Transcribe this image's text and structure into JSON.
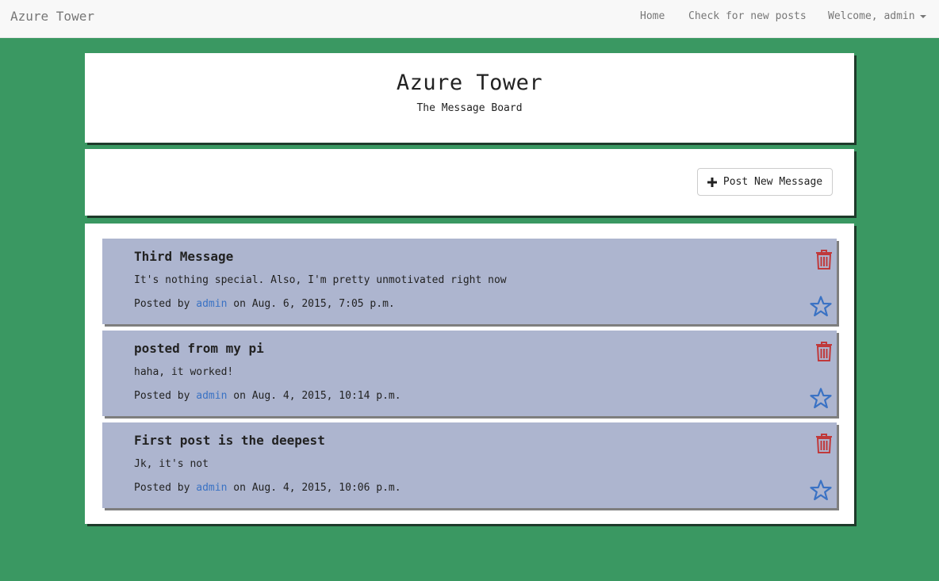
{
  "navbar": {
    "brand": "Azure Tower",
    "links": {
      "home": "Home",
      "check_posts": "Check for new posts",
      "user_menu": "Welcome, admin"
    }
  },
  "header": {
    "title": "Azure Tower",
    "subtitle": "The Message Board"
  },
  "actions": {
    "post_new_label": "Post New Message"
  },
  "messages": [
    {
      "title": "Third Message",
      "body": "It's nothing special. Also, I'm pretty unmotivated right now",
      "posted_by_prefix": "Posted by",
      "author": "admin",
      "date_text": "on Aug. 6, 2015, 7:05 p.m."
    },
    {
      "title": "posted from my pi",
      "body": "haha, it worked!",
      "posted_by_prefix": "Posted by",
      "author": "admin",
      "date_text": "on Aug. 4, 2015, 10:14 p.m."
    },
    {
      "title": "First post is the deepest",
      "body": "Jk, it's not",
      "posted_by_prefix": "Posted by",
      "author": "admin",
      "date_text": "on Aug. 4, 2015, 10:06 p.m."
    }
  ],
  "icons": {
    "post_new": "plus-icon",
    "delete": "trash-icon",
    "favorite": "star-icon",
    "user_menu": "caret-down-icon"
  },
  "colors": {
    "background": "#3a9862",
    "message_bg": "#adb5cf",
    "delete": "#c0393b",
    "favorite": "#3a72c4",
    "link": "#3a72c4"
  }
}
